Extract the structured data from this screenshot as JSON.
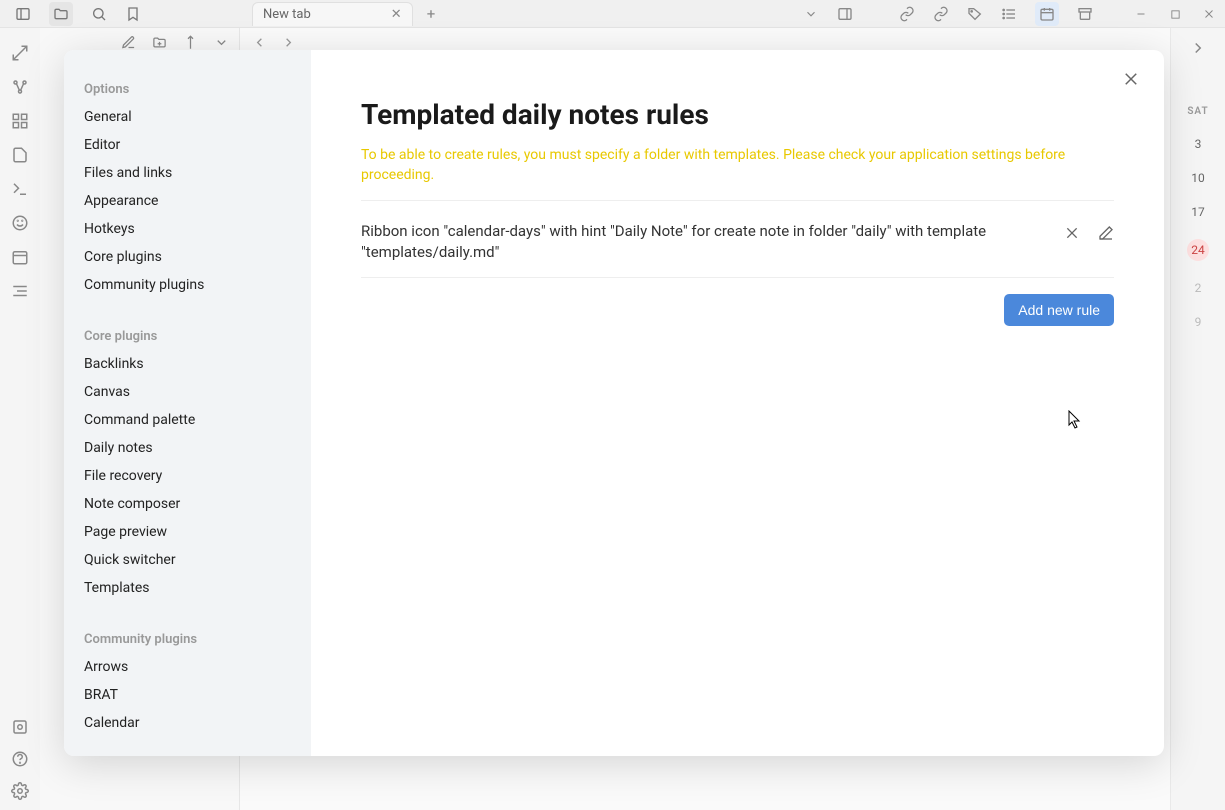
{
  "titlebar": {
    "tab_label": "New tab",
    "content_title": "New tab"
  },
  "modal": {
    "sections": [
      {
        "title": "Options",
        "items": [
          "General",
          "Editor",
          "Files and links",
          "Appearance",
          "Hotkeys",
          "Core plugins",
          "Community plugins"
        ]
      },
      {
        "title": "Core plugins",
        "items": [
          "Backlinks",
          "Canvas",
          "Command palette",
          "Daily notes",
          "File recovery",
          "Note composer",
          "Page preview",
          "Quick switcher",
          "Templates"
        ]
      },
      {
        "title": "Community plugins",
        "items": [
          "Arrows",
          "BRAT",
          "Calendar"
        ]
      }
    ],
    "title": "Templated daily notes rules",
    "warning": "To be able to create rules, you must specify a folder with templates. Please check your application settings before proceeding.",
    "rule_text": "Ribbon icon \"calendar-days\" with hint \"Daily Note\" for create note in folder \"daily\" with template \"templates/daily.md\"",
    "add_button": "Add new rule"
  },
  "calendar": {
    "header": "SAT",
    "days": [
      "3",
      "10",
      "17",
      "24",
      "2",
      "9"
    ]
  }
}
